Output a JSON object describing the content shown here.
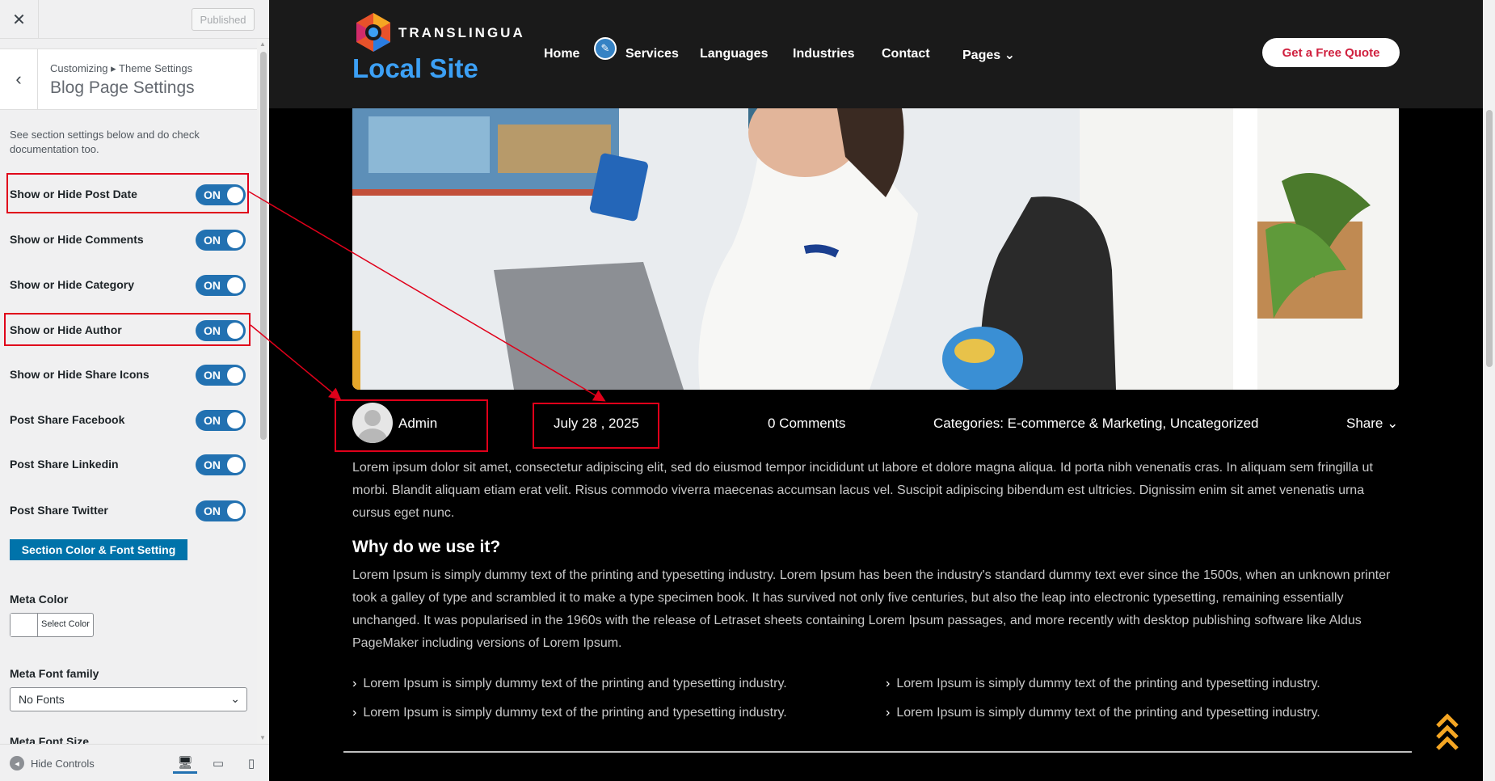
{
  "customizer": {
    "close_icon": "close-icon",
    "publish_label": "Published",
    "breadcrumb": "Customizing ▸ Theme Settings",
    "section_title": "Blog Page Settings",
    "description": "See section settings below and do check documentation too.",
    "toggles": [
      {
        "label": "Show or Hide Post Date",
        "state": "ON",
        "highlighted": true
      },
      {
        "label": "Show or Hide Comments",
        "state": "ON"
      },
      {
        "label": "Show or Hide Category",
        "state": "ON"
      },
      {
        "label": "Show or Hide Author",
        "state": "ON",
        "highlighted": true
      },
      {
        "label": "Show or Hide Share Icons",
        "state": "ON"
      },
      {
        "label": "Post Share Facebook",
        "state": "ON"
      },
      {
        "label": "Post Share Linkedin",
        "state": "ON"
      },
      {
        "label": "Post Share Twitter",
        "state": "ON"
      }
    ],
    "section_button": "Section Color & Font Setting",
    "meta_color_label": "Meta Color",
    "select_color_label": "Select Color",
    "meta_font_family_label": "Meta Font family",
    "meta_font_family_value": "No Fonts",
    "meta_font_size_label": "Meta Font Size",
    "hide_controls_label": "Hide Controls",
    "accent_color": "#2271b1"
  },
  "site": {
    "brand_name": "TRANSLINGUA",
    "site_title": "Local Site",
    "nav": [
      "Home",
      "Services",
      "Languages",
      "Industries",
      "Contact",
      "Pages"
    ],
    "cta_label": "Get a Free Quote",
    "cta_color": "#d0213f",
    "title_color": "#3ca0f5"
  },
  "post": {
    "author": "Admin",
    "date": "July 28 , 2025",
    "comments": "0 Comments",
    "categories": "Categories: E-commerce & Marketing, Uncategorized",
    "share_label": "Share",
    "paragraph1": "Lorem ipsum dolor sit amet, consectetur adipiscing elit, sed do eiusmod tempor incididunt ut labore et dolore magna aliqua. Id porta nibh venenatis cras. In aliquam sem fringilla ut morbi. Blandit aliquam etiam erat velit. Risus commodo viverra maecenas accumsan lacus vel. Suscipit adipiscing bibendum est ultricies. Dignissim enim sit amet venenatis urna cursus eget nunc.",
    "heading": "Why do we use it?",
    "paragraph2": "Lorem Ipsum is simply dummy text of the printing and typesetting industry. Lorem Ipsum has been the industry's standard dummy text ever since the 1500s, when an unknown printer took a galley of type and scrambled it to make a type specimen book. It has survived not only five centuries, but also the leap into electronic typesetting, remaining essentially unchanged. It was popularised in the 1960s with the release of Letraset sheets containing Lorem Ipsum passages, and more recently with desktop publishing software like Aldus PageMaker including versions of Lorem Ipsum.",
    "bullets": [
      "Lorem Ipsum is simply dummy text of the printing and typesetting industry.",
      "Lorem Ipsum is simply dummy text of the printing and typesetting industry.",
      "Lorem Ipsum is simply dummy text of the printing and typesetting industry.",
      "Lorem Ipsum is simply dummy text of the printing and typesetting industry."
    ]
  },
  "annotation_color": "#e0001a"
}
